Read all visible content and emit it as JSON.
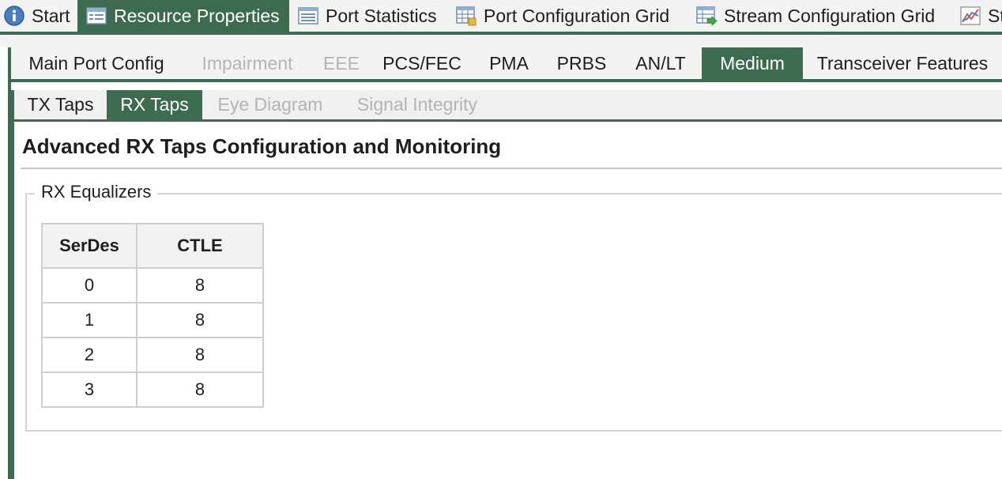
{
  "top_tabs": [
    {
      "label": "Start",
      "icon": "info-icon",
      "active": false
    },
    {
      "label": "Resource Properties",
      "icon": "properties-icon",
      "active": true
    },
    {
      "label": "Port Statistics",
      "icon": "statistics-icon",
      "active": false
    },
    {
      "label": "Port Configuration Grid",
      "icon": "grid-config-icon",
      "active": false
    },
    {
      "label": "Stream Configuration Grid",
      "icon": "stream-grid-icon",
      "active": false
    },
    {
      "label": "St",
      "icon": "chart-icon",
      "active": false
    }
  ],
  "port_tabs": [
    {
      "label": "Main Port Config",
      "state": "normal"
    },
    {
      "label": "Impairment",
      "state": "disabled"
    },
    {
      "label": "EEE",
      "state": "disabled"
    },
    {
      "label": "PCS/FEC",
      "state": "normal"
    },
    {
      "label": "PMA",
      "state": "normal"
    },
    {
      "label": "PRBS",
      "state": "normal"
    },
    {
      "label": "AN/LT",
      "state": "normal"
    },
    {
      "label": "Medium",
      "state": "active"
    },
    {
      "label": "Transceiver Features",
      "state": "normal"
    }
  ],
  "medium_tabs": [
    {
      "label": "TX Taps",
      "state": "normal"
    },
    {
      "label": "RX Taps",
      "state": "active"
    },
    {
      "label": "Eye Diagram",
      "state": "disabled"
    },
    {
      "label": "Signal Integrity",
      "state": "disabled"
    }
  ],
  "content": {
    "title": "Advanced RX Taps Configuration and Monitoring",
    "group_label": "RX Equalizers",
    "table": {
      "headers": [
        "SerDes",
        "CTLE"
      ],
      "rows": [
        [
          "0",
          "8"
        ],
        [
          "1",
          "8"
        ],
        [
          "2",
          "8"
        ],
        [
          "3",
          "8"
        ]
      ]
    }
  },
  "colors": {
    "accent": "#3d6b4f",
    "disabled_text": "#b4b4b4",
    "tab_background": "#f3f3f3"
  }
}
